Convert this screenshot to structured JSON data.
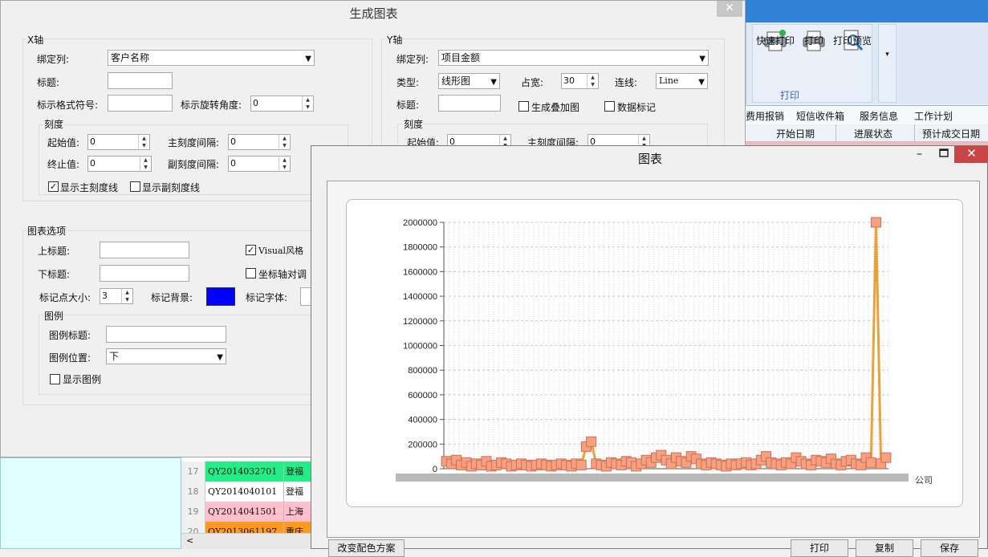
{
  "background_app": {
    "ribbon": {
      "buttons": [
        {
          "label": "快速打印",
          "icon": "quick-print-icon"
        },
        {
          "label": "打印",
          "icon": "printer-icon"
        },
        {
          "label": "打印预览",
          "icon": "print-preview-icon"
        }
      ],
      "group_label": "打印"
    },
    "tabs": [
      "费用报销",
      "短信收件箱",
      "服务信息",
      "工作计划"
    ],
    "grid_headers": [
      "开始日期",
      "进展状态",
      "预计成交日期"
    ],
    "rows": [
      {
        "num": "17",
        "code": "QY2014032701",
        "name": "登福",
        "bg": "#22ee88"
      },
      {
        "num": "18",
        "code": "QY2014040101",
        "name": "登福",
        "bg": "#ffffff"
      },
      {
        "num": "19",
        "code": "QY2014041501",
        "name": "上海",
        "bg": "#ffc0cb"
      },
      {
        "num": "20",
        "code": "QY2013061197",
        "name": "重庆",
        "bg": "#ff9a1e"
      }
    ]
  },
  "config_dialog": {
    "title": "生成图表",
    "x_axis": {
      "group": "X轴",
      "bind_label": "绑定列:",
      "bind_value": "客户名称",
      "title_label": "标题:",
      "title_value": "",
      "format_label": "标示格式符号:",
      "format_value": "",
      "rotate_label": "标示旋转角度:",
      "rotate_value": "0",
      "scale_group": "刻度",
      "start_label": "起始值:",
      "start_value": "0",
      "end_label": "终止值:",
      "end_value": "0",
      "major_label": "主刻度间隔:",
      "major_value": "0",
      "minor_label": "副刻度间隔:",
      "minor_value": "0",
      "show_major_label": "显示主刻度线",
      "show_major_checked": true,
      "show_minor_label": "显示副刻度线",
      "show_minor_checked": false
    },
    "y_axis": {
      "group": "Y轴",
      "bind_label": "绑定列:",
      "bind_value": "项目金额",
      "type_label": "类型:",
      "type_value": "线形图",
      "width_label": "占宽:",
      "width_value": "30",
      "line_label": "连线:",
      "line_value": "Line",
      "title_label": "标题:",
      "title_value": "",
      "overlay_label": "生成叠加图",
      "overlay_checked": false,
      "marker_label": "数据标记",
      "marker_checked": false,
      "scale_group": "刻度",
      "start_label": "起始值:",
      "start_value": "0",
      "major_label": "主刻度间隔:",
      "major_value": "0"
    },
    "chart_options": {
      "group": "图表选项",
      "top_title_label": "上标题:",
      "top_title_value": "",
      "bottom_title_label": "下标题:",
      "bottom_title_value": "",
      "visual_label": "Visual风格",
      "visual_checked": true,
      "swap_label": "坐标轴对调",
      "swap_checked": false,
      "marker_size_label": "标记点大小:",
      "marker_size_value": "3",
      "marker_bg_label": "标记背景:",
      "marker_bg_color": "#0000ff",
      "marker_font_label": "标记字体:",
      "legend_group": "图例",
      "legend_title_label": "图例标题:",
      "legend_title_value": "",
      "legend_pos_label": "图例位置:",
      "legend_pos_value": "下",
      "show_legend_label": "显示图例",
      "show_legend_checked": false
    }
  },
  "chart_window": {
    "title": "图表",
    "buttons": {
      "color_scheme": "改变配色方案",
      "print": "打印",
      "copy": "复制",
      "save": "保存"
    },
    "x_label_right": "公司"
  },
  "chart_data": {
    "type": "line",
    "ylim": [
      0,
      2000000
    ],
    "y_ticks": [
      "0",
      "200000",
      "400000",
      "600000",
      "800000",
      "1000000",
      "1200000",
      "1400000",
      "1600000",
      "1800000",
      "2000000"
    ],
    "grid": true,
    "marker_color": "#f4a183",
    "line_color": "#e8a33a",
    "values": [
      60000,
      40000,
      70000,
      30000,
      50000,
      20000,
      40000,
      30000,
      60000,
      20000,
      30000,
      50000,
      40000,
      20000,
      30000,
      40000,
      30000,
      20000,
      30000,
      40000,
      30000,
      20000,
      30000,
      40000,
      30000,
      20000,
      40000,
      30000,
      180000,
      220000,
      40000,
      30000,
      20000,
      50000,
      40000,
      30000,
      60000,
      50000,
      20000,
      40000,
      70000,
      50000,
      90000,
      110000,
      70000,
      40000,
      90000,
      60000,
      50000,
      100000,
      80000,
      40000,
      30000,
      50000,
      40000,
      30000,
      20000,
      40000,
      30000,
      40000,
      50000,
      30000,
      40000,
      70000,
      100000,
      50000,
      40000,
      30000,
      50000,
      40000,
      90000,
      60000,
      40000,
      30000,
      70000,
      60000,
      50000,
      80000,
      40000,
      30000,
      60000,
      70000,
      40000,
      30000,
      90000,
      50000,
      2000000,
      40000,
      90000
    ]
  }
}
